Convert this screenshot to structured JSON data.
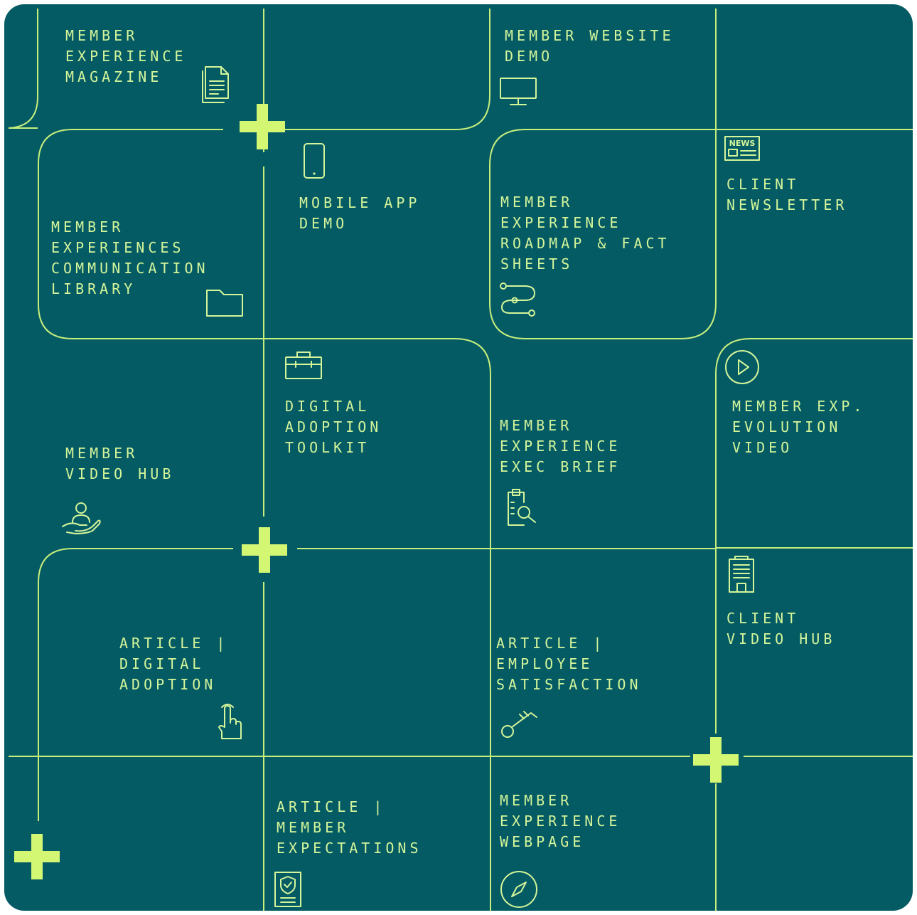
{
  "theme": {
    "background": "#045b64",
    "line": "#c6ef7c",
    "text": "#d4f59a",
    "plus": "#d4f773"
  },
  "tiles": [
    {
      "label": [
        "MEMBER",
        "EXPERIENCE",
        "MAGAZINE"
      ],
      "icon": "document-icon"
    },
    {
      "label": [
        "MEMBER WEBSITE",
        "DEMO"
      ],
      "icon": "monitor-icon"
    },
    {
      "label": [
        "MOBILE APP",
        "DEMO"
      ],
      "icon": "smartphone-icon"
    },
    {
      "label": [
        "MEMBER",
        "EXPERIENCES",
        "COMMUNICATION",
        "LIBRARY"
      ],
      "icon": "folder-icon"
    },
    {
      "label": [
        "MEMBER",
        "EXPERIENCE",
        "ROADMAP & FACT",
        "SHEETS"
      ],
      "icon": "route-icon"
    },
    {
      "label": [
        "CLIENT",
        "NEWSLETTER"
      ],
      "icon": "news-icon",
      "icon_text": "NEWS"
    },
    {
      "label": [
        "DIGITAL",
        "ADOPTION",
        "TOOLKIT"
      ],
      "icon": "briefcase-icon"
    },
    {
      "label": [
        "MEMBER",
        "VIDEO HUB"
      ],
      "icon": "hand-user-icon"
    },
    {
      "label": [
        "MEMBER",
        "EXPERIENCE",
        "EXEC BRIEF"
      ],
      "icon": "clipboard-search-icon"
    },
    {
      "label": [
        "MEMBER EXP.",
        "EVOLUTION",
        "VIDEO"
      ],
      "icon": "play-circle-icon"
    },
    {
      "label": [
        "CLIENT",
        "VIDEO HUB"
      ],
      "icon": "building-icon"
    },
    {
      "label": [
        "ARTICLE |",
        "DIGITAL",
        "ADOPTION"
      ],
      "icon": "pointer-hand-icon"
    },
    {
      "label": [
        "ARTICLE |",
        "EMPLOYEE",
        "SATISFACTION"
      ],
      "icon": "key-icon"
    },
    {
      "label": [
        "ARTICLE |",
        "MEMBER",
        "EXPECTATIONS"
      ],
      "icon": "shield-document-icon"
    },
    {
      "label": [
        "MEMBER",
        "EXPERIENCE",
        "WEBPAGE"
      ],
      "icon": "compass-icon"
    }
  ]
}
